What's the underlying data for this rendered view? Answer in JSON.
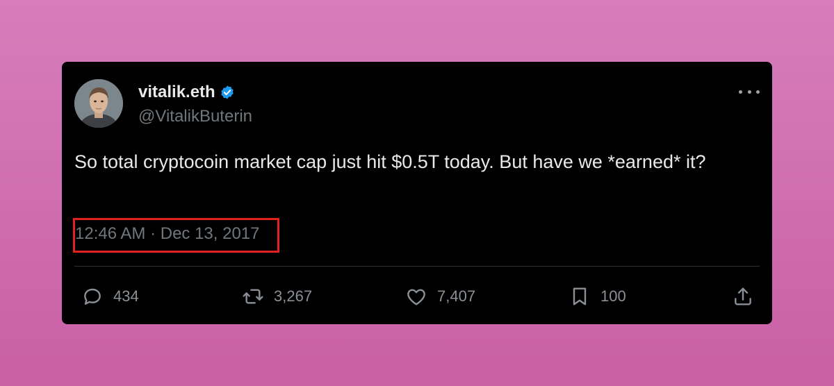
{
  "tweet": {
    "display_name": "vitalik.eth",
    "handle": "@VitalikButerin",
    "text": "So total cryptocoin market cap just hit $0.5T today. But have we *earned* it?",
    "timestamp": "12:46 AM · Dec 13, 2017"
  },
  "actions": {
    "replies": "434",
    "reposts": "3,267",
    "likes": "7,407",
    "bookmarks": "100"
  },
  "icons": {
    "verified": "verified-badge-icon",
    "more": "more-horizontal-icon",
    "reply": "reply-icon",
    "repost": "repost-icon",
    "like": "heart-icon",
    "bookmark": "bookmark-icon",
    "share": "share-icon"
  },
  "colors": {
    "background": "#d77dbb",
    "card": "#000000",
    "primary_text": "#e7e9ea",
    "secondary_text": "#71767b",
    "verified_blue": "#1d9bf0",
    "highlight_box": "#e3211d"
  }
}
